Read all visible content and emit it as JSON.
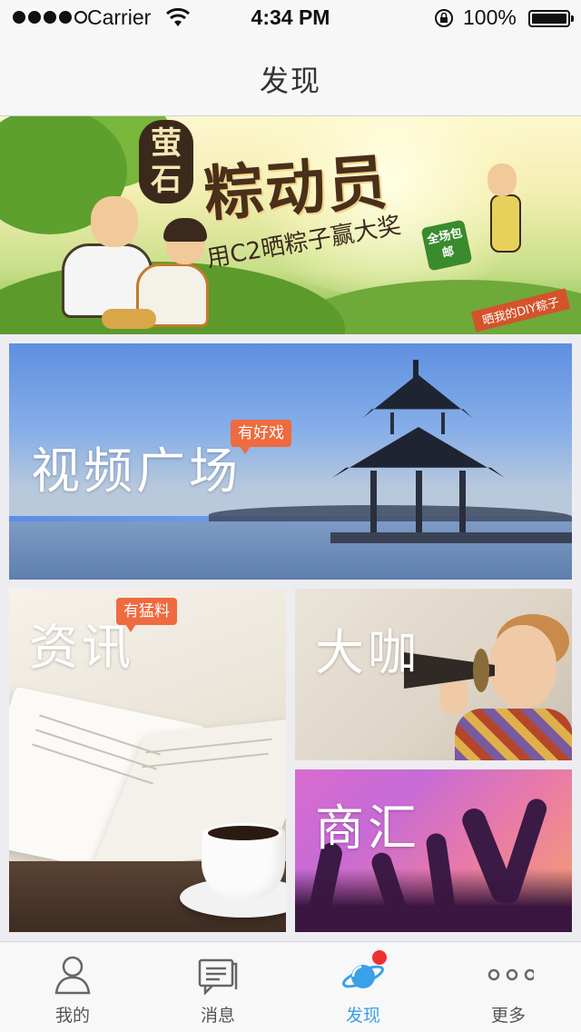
{
  "status_bar": {
    "carrier": "Carrier",
    "time": "4:34 PM",
    "battery": "100%",
    "signal_bars_filled": 4,
    "signal_bars_total": 5
  },
  "nav": {
    "title": "发现"
  },
  "banner": {
    "brand": [
      "萤",
      "石"
    ],
    "title": "粽动员",
    "subtitle": "用C2晒粽子赢大奖",
    "tag": "全场包邮",
    "ribbon": "晒我的DIY粽子"
  },
  "tiles": {
    "video": {
      "label": "视频广场",
      "tag": "有好戏"
    },
    "news": {
      "label": "资讯",
      "tag": "有猛料"
    },
    "kol": {
      "label": "大咖"
    },
    "biz": {
      "label": "商汇"
    }
  },
  "tabbar": {
    "items": [
      {
        "label": "我的",
        "icon": "person-icon",
        "active": false
      },
      {
        "label": "消息",
        "icon": "message-icon",
        "active": false
      },
      {
        "label": "发现",
        "icon": "planet-icon",
        "active": true
      },
      {
        "label": "更多",
        "icon": "more-dots-icon",
        "active": false
      }
    ],
    "active_color": "#3aa0e8",
    "badge_color": "#f02f2f"
  },
  "colors": {
    "tag": "#ef6a3f",
    "nav_bg": "#f7f7f8",
    "page_bg": "#ededf1"
  }
}
